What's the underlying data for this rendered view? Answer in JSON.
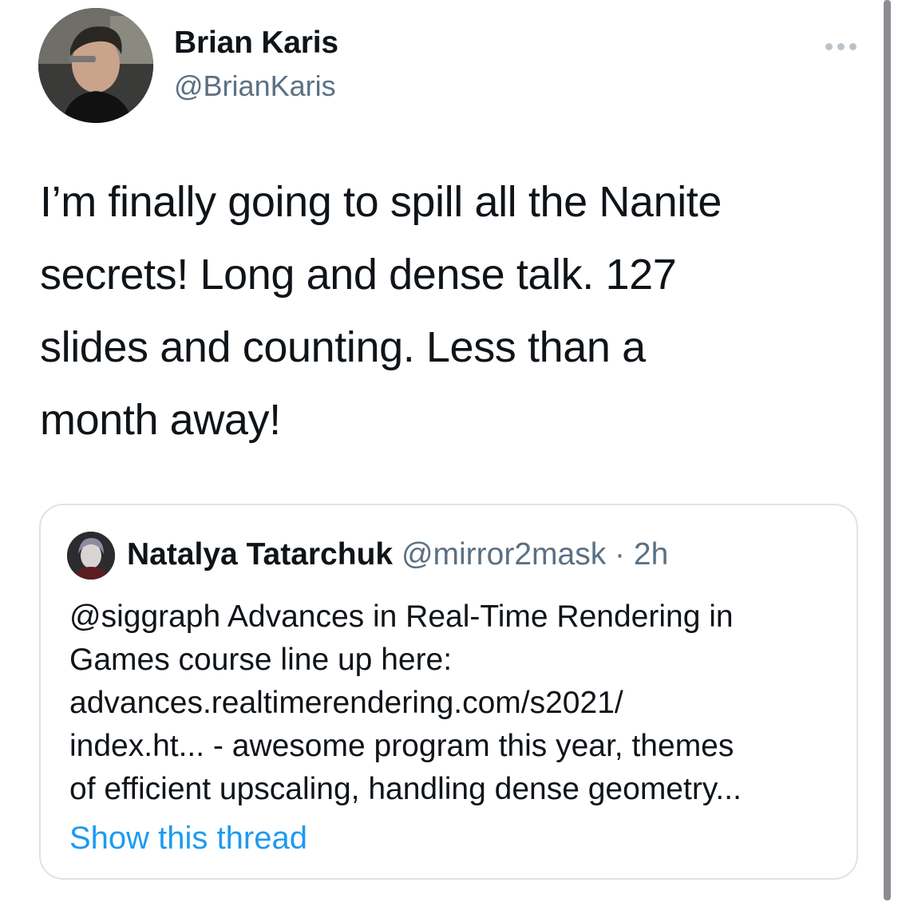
{
  "tweet": {
    "author": {
      "name": "Brian Karis",
      "handle": "@BrianKaris",
      "avatar_icon": "profile-photo"
    },
    "more_icon": "more-options-icon",
    "text_lines": [
      "I’m finally going to spill all the Nanite",
      "secrets! Long and dense talk. 127",
      "slides and counting. Less than a",
      "month away!"
    ]
  },
  "quoted_tweet": {
    "author": {
      "name": "Natalya Tatarchuk",
      "handle": "@mirror2mask",
      "separator": "·",
      "time": "2h",
      "avatar_icon": "profile-photo"
    },
    "text_lines": [
      "@siggraph Advances in Real-Time Rendering in",
      "Games course line up here:",
      "advances.realtimerendering.com/s2021/",
      "index.ht... - awesome program this year, themes",
      "of efficient upscaling, handling dense geometry..."
    ],
    "show_thread_label": "Show this thread"
  },
  "colors": {
    "primary_text": "#0f1419",
    "secondary_text": "#5b7083",
    "link": "#1d9bf0",
    "border": "#dfe3e7"
  }
}
